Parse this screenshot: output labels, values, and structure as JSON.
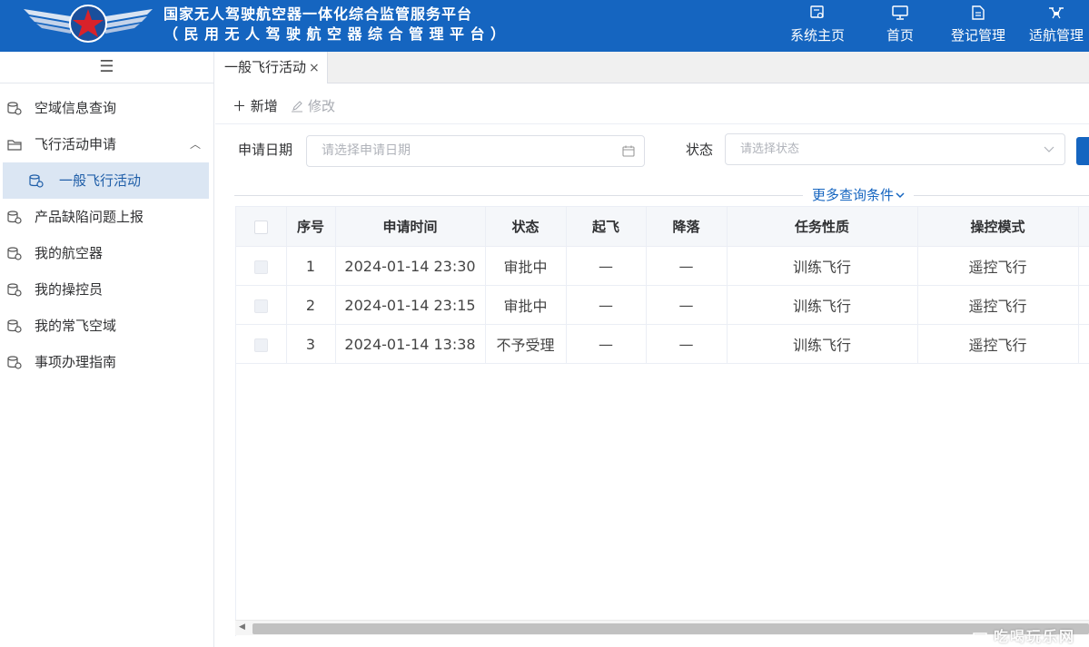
{
  "header": {
    "title_line1": "国家无人驾驶航空器一体化综合监管服务平台",
    "title_line2": "（民用无人驾驶航空器综合管理平台）",
    "nav": [
      {
        "label": "系统主页",
        "icon": "doc-search-icon"
      },
      {
        "label": "首页",
        "icon": "monitor-icon"
      },
      {
        "label": "登记管理",
        "icon": "register-doc-icon"
      },
      {
        "label": "适航管理",
        "icon": "drone-icon"
      }
    ]
  },
  "sidebar": {
    "toggle": "☰",
    "items": [
      {
        "label": "空域信息查询"
      },
      {
        "label": "飞行活动申请",
        "expanded": true
      },
      {
        "label": "一般飞行活动",
        "active": true
      },
      {
        "label": "产品缺陷问题上报"
      },
      {
        "label": "我的航空器"
      },
      {
        "label": "我的操控员"
      },
      {
        "label": "我的常飞空域"
      },
      {
        "label": "事项办理指南"
      }
    ]
  },
  "tabs": [
    {
      "label": "一般飞行活动",
      "close": "×"
    }
  ],
  "toolbar": {
    "add_label": "＋ 新增",
    "edit_label": "修改"
  },
  "filters": {
    "date_label": "申请日期",
    "date_placeholder": "请选择申请日期",
    "status_label": "状态",
    "status_placeholder": "请选择状态",
    "more_label": "更多查询条件"
  },
  "table": {
    "columns": [
      "序号",
      "申请时间",
      "状态",
      "起飞",
      "降落",
      "任务性质",
      "操控模式"
    ],
    "rows": [
      [
        "1",
        "2024-01-14 23:30",
        "审批中",
        "—",
        "—",
        "训练飞行",
        "遥控飞行"
      ],
      [
        "2",
        "2024-01-14 23:15",
        "审批中",
        "—",
        "—",
        "训练飞行",
        "遥控飞行"
      ],
      [
        "3",
        "2024-01-14 13:38",
        "不予受理",
        "—",
        "—",
        "训练飞行",
        "遥控飞行"
      ]
    ]
  },
  "watermark": "吃喝玩乐网",
  "colors": {
    "header_bg": "#1565c0",
    "active_menu_bg": "#dbe6f3",
    "link": "#1565c0"
  }
}
